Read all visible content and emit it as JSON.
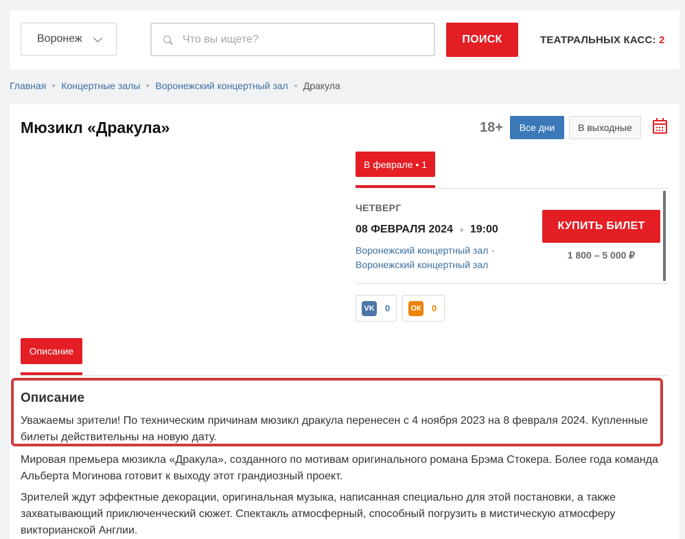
{
  "header": {
    "city": "Воронеж",
    "search_placeholder": "Что вы ищете?",
    "search_button": "ПОИСК",
    "boxoffice_label": "ТЕАТРАЛЬНЫХ КАСС:",
    "boxoffice_count": "2"
  },
  "breadcrumbs": [
    "Главная",
    "Концертные залы",
    "Воронежский концертный зал",
    "Дракула"
  ],
  "event": {
    "title": "Мюзикл «Дракула»",
    "age": "18+",
    "filter_all_days": "Все дни",
    "filter_weekend": "В выходные",
    "month_tab": "В феврале • 1",
    "session": {
      "weekday": "ЧЕТВЕРГ",
      "date": "08 ФЕВРАЛЯ 2024",
      "time": "19:00",
      "venue_1": "Воронежский концертный зал",
      "venue_2": "Воронежский концертный зал",
      "buy_button": "КУПИТЬ БИЛЕТ",
      "price": "1 800 – 5 000 ₽"
    },
    "share": {
      "vk_label": "VK",
      "vk_icon": "vk-icon",
      "vk_count": "0",
      "ok_label": "ОК",
      "ok_icon": "odnoklassniki-icon",
      "ok_count": "0"
    }
  },
  "description": {
    "tab_label": "Описание",
    "heading": "Описание",
    "paragraphs": [
      "Уважаемы зрители! По техническим причинам мюзикл дракула перенесен с 4 ноября 2023 на 8 февраля 2024. Купленные билеты действительны на новую дату.",
      "Мировая премьера мюзикла «Дракула», созданного по мотивам оригинального романа Брэма Стокера. Более года команда Альберта Могинова готовит к выходу этот грандиозный проект.",
      "Зрителей ждут эффектные декорации, оригинальная музыка, написанная специально для этой постановки, а также захватывающий приключенческий сюжет. Спектакль атмосферный, способный погрузить в мистическую атмосферу викторианской Англии."
    ]
  },
  "colors": {
    "accent": "#e31e24",
    "link": "#3b6fa0",
    "button_blue": "#3b78b8",
    "vk": "#4a76a8",
    "ok": "#ee8208",
    "highlight_border": "#cd3c3c"
  }
}
